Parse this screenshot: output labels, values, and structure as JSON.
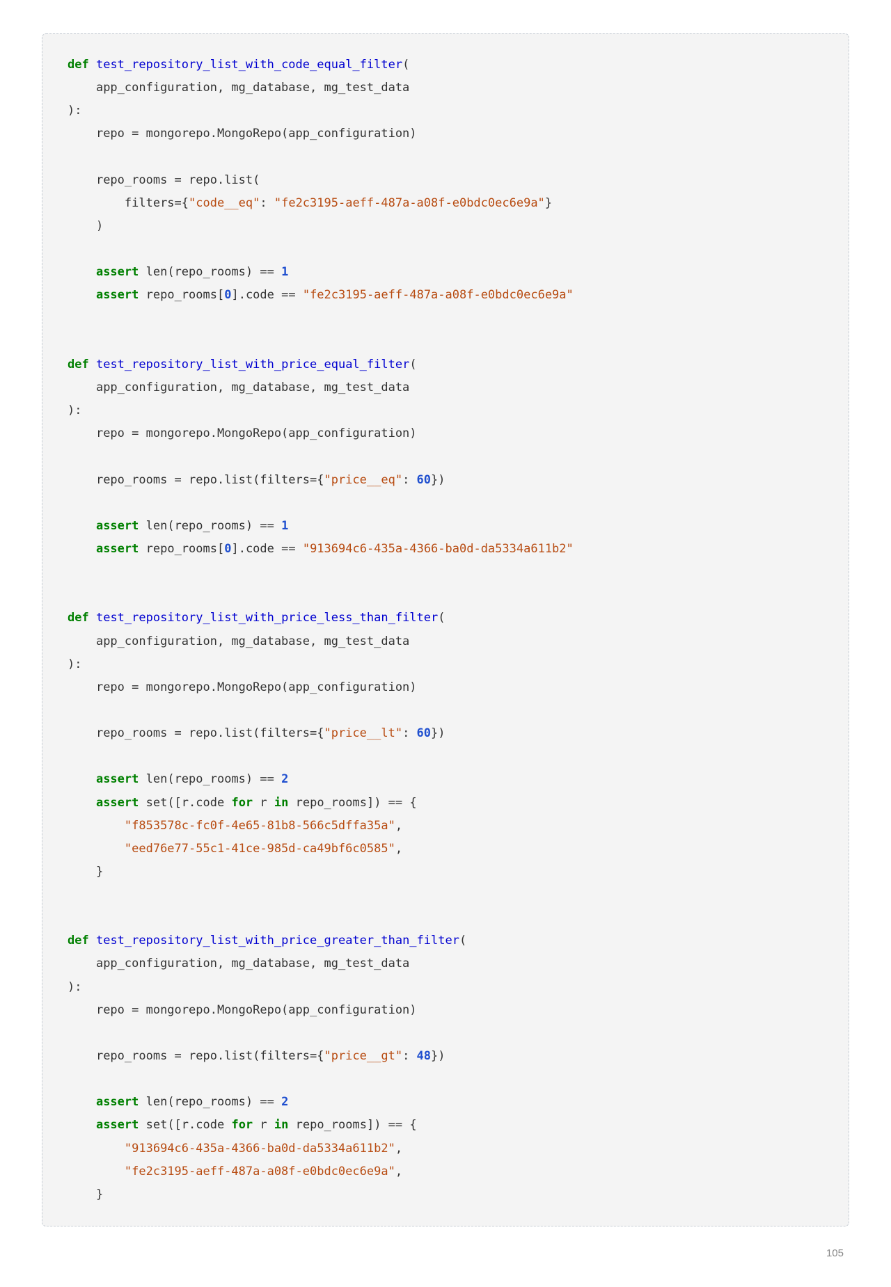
{
  "page_number": "105",
  "code": {
    "functions": [
      {
        "name": "test_repository_list_with_code_equal_filter",
        "params": "app_configuration, mg_database, mg_test_data",
        "filter_key": "\"code__eq\"",
        "filter_value_str": "\"fe2c3195-aeff-487a-a08f-e0bdc0ec6e9a\"",
        "assert_len": "1",
        "assert_idx": "0",
        "assert_code_str": "\"fe2c3195-aeff-487a-a08f-e0bdc0ec6e9a\"",
        "multiline_filter": true
      },
      {
        "name": "test_repository_list_with_price_equal_filter",
        "params": "app_configuration, mg_database, mg_test_data",
        "filter_key": "\"price__eq\"",
        "filter_value_num": "60",
        "assert_len": "1",
        "assert_idx": "0",
        "assert_code_str": "\"913694c6-435a-4366-ba0d-da5334a611b2\""
      },
      {
        "name": "test_repository_list_with_price_less_than_filter",
        "params": "app_configuration, mg_database, mg_test_data",
        "filter_key": "\"price__lt\"",
        "filter_value_num": "60",
        "assert_len": "2",
        "set_codes": [
          "\"f853578c-fc0f-4e65-81b8-566c5dffa35a\"",
          "\"eed76e77-55c1-41ce-985d-ca49bf6c0585\""
        ]
      },
      {
        "name": "test_repository_list_with_price_greater_than_filter",
        "params": "app_configuration, mg_database, mg_test_data",
        "filter_key": "\"price__gt\"",
        "filter_value_num": "48",
        "assert_len": "2",
        "set_codes": [
          "\"913694c6-435a-4366-ba0d-da5334a611b2\"",
          "\"fe2c3195-aeff-487a-a08f-e0bdc0ec6e9a\""
        ]
      }
    ],
    "tokens": {
      "def": "def",
      "assert": "assert",
      "for": "for",
      "in": "in",
      "repo_assign": "repo = mongorepo.MongoRepo(app_configuration)",
      "repo_rooms_list": "repo_rooms = repo.list(",
      "repo_rooms_list_inline": "repo_rooms = repo.list(filters={",
      "filters_open": "filters={",
      "len_call": "len(repo_rooms) == ",
      "repo_rooms_idx": "repo_rooms[",
      "code_attr": "].code == ",
      "set_open": "set([r.code ",
      "set_mid": " r ",
      "set_end": " repo_rooms]) == {"
    }
  }
}
